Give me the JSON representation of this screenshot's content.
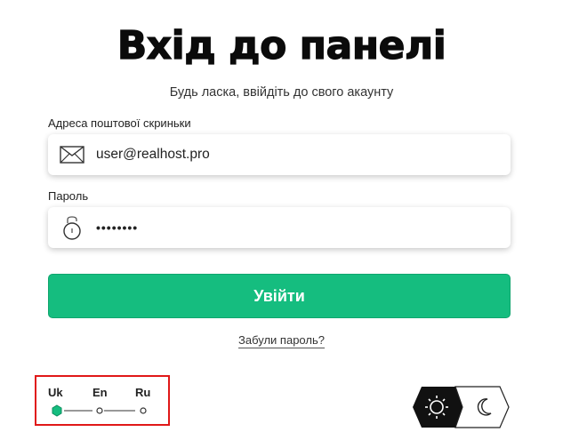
{
  "header": {
    "title": "Вхід до панелі",
    "subtitle": "Будь ласка, ввійдіть до свого акаунту"
  },
  "form": {
    "email_label": "Адреса поштової скриньки",
    "email_value": "user@realhost.pro",
    "email_icon": "envelope-icon",
    "password_label": "Пароль",
    "password_value": "••••••••",
    "password_icon": "lock-icon",
    "submit_label": "Увійти",
    "forgot_label": "Забули пароль?"
  },
  "language": {
    "options": [
      "Uk",
      "En",
      "Ru"
    ],
    "selected": "Uk"
  },
  "theme": {
    "options": [
      "sun-icon",
      "moon-icon"
    ],
    "selected": "light"
  },
  "colors": {
    "accent": "#15bd7f",
    "dark": "#111111",
    "highlight_border": "#e01818"
  }
}
